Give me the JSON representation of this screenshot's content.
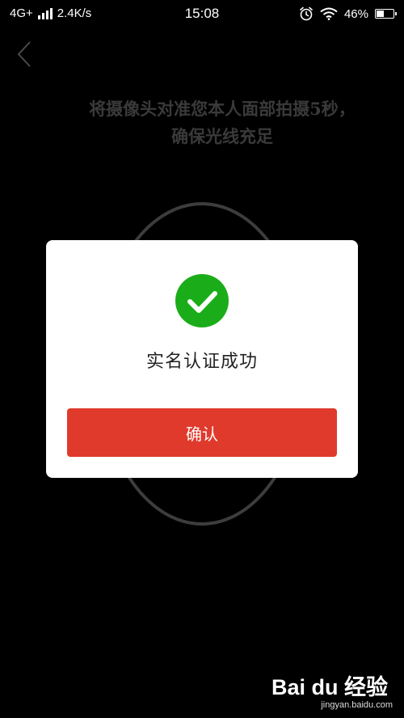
{
  "status_bar": {
    "network": "4G+",
    "speed": "2.4K/s",
    "time": "15:08",
    "battery_percent": "46%",
    "battery_level": 0.46,
    "icons": [
      "signal-icon",
      "alarm-icon",
      "wifi-icon",
      "battery-icon"
    ]
  },
  "nav": {
    "back_icon": "chevron-left-icon"
  },
  "instruction": {
    "text": "将摄像头对准您本人面部拍摄5秒， 确保光线充足"
  },
  "dialog": {
    "icon": "check-circle-icon",
    "message": "实名认证成功",
    "confirm_label": "确认"
  },
  "watermark": {
    "logo_text": "Bai du 经验",
    "url": "jingyan.baidu.com"
  },
  "colors": {
    "background": "#000000",
    "dialog_bg": "#ffffff",
    "success_green": "#1aad19",
    "confirm_red": "#e03a2c",
    "instruction_text": "#3a3a3a"
  }
}
